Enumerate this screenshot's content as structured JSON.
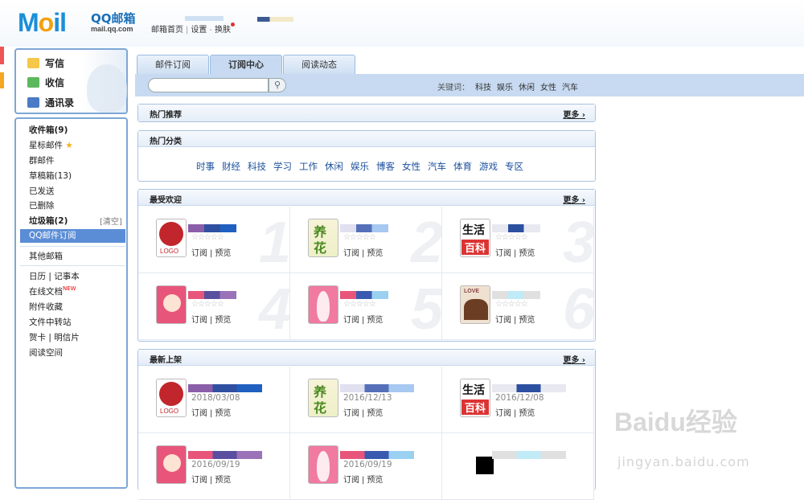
{
  "header": {
    "logo_text": "Mail",
    "brand": "QQ邮箱",
    "domain": "mail.qq.com",
    "links": [
      "邮箱首页",
      "设置",
      "换肤"
    ]
  },
  "sidebar": {
    "actions": [
      {
        "label": "写信",
        "icon": "compose-icon"
      },
      {
        "label": "收信",
        "icon": "inbox-download-icon"
      },
      {
        "label": "通讯录",
        "icon": "contacts-icon"
      }
    ],
    "folders": [
      {
        "label": "收件箱(9)",
        "bold": true
      },
      {
        "label": "星标邮件",
        "star": true
      },
      {
        "label": "群邮件"
      },
      {
        "label": "草稿箱(13)"
      },
      {
        "label": "已发送"
      },
      {
        "label": "已删除"
      },
      {
        "label": "垃圾箱(2)",
        "bold": true
      },
      {
        "label": "QQ邮件订阅",
        "selected": true
      },
      {
        "label": "其他邮箱"
      },
      {
        "label": "日历 | 记事本"
      },
      {
        "label": "在线文档"
      },
      {
        "label": "附件收藏"
      },
      {
        "label": "文件中转站"
      },
      {
        "label": "贺卡 | 明信片"
      },
      {
        "label": "阅读空间"
      }
    ],
    "clear_label": "[清空]",
    "new_badge": "NEW"
  },
  "main": {
    "tabs": [
      {
        "label": "邮件订阅",
        "active": false
      },
      {
        "label": "订阅中心",
        "active": true
      },
      {
        "label": "阅读动态",
        "active": false
      }
    ],
    "search": {
      "placeholder": "",
      "button_icon": "magnifier-icon"
    },
    "keywords_label": "关键词：",
    "keywords": [
      "科技",
      "娱乐",
      "休闲",
      "女性",
      "汽车"
    ],
    "hot_recommend": {
      "title": "热门推荐",
      "more": "更多"
    },
    "hot_categories": {
      "title": "热门分类",
      "items": [
        "时事",
        "财经",
        "科技",
        "学习",
        "工作",
        "休闲",
        "娱乐",
        "博客",
        "女性",
        "汽车",
        "体育",
        "游戏",
        "专区"
      ]
    },
    "popular": {
      "title": "最受欢迎",
      "more": "更多",
      "items": [
        {
          "num": "1",
          "thumb": "logo",
          "stars": "☆☆☆☆☆"
        },
        {
          "num": "2",
          "thumb": "yang",
          "stars": "☆☆☆☆☆"
        },
        {
          "num": "3",
          "thumb": "life",
          "stars": "☆☆☆☆☆"
        },
        {
          "num": "4",
          "thumb": "baby",
          "stars": "☆☆☆☆☆"
        },
        {
          "num": "5",
          "thumb": "preg",
          "stars": "☆☆☆☆☆"
        },
        {
          "num": "6",
          "thumb": "love",
          "stars": "☆☆☆☆☆"
        }
      ]
    },
    "latest": {
      "title": "最新上架",
      "more": "更多",
      "items": [
        {
          "thumb": "logo",
          "date": "2018/03/08"
        },
        {
          "thumb": "yang",
          "date": "2016/12/13"
        },
        {
          "thumb": "life",
          "date": "2016/12/08"
        },
        {
          "thumb": "baby",
          "date": "2016/09/19"
        },
        {
          "thumb": "preg",
          "date": "2016/09/19"
        },
        {
          "thumb": "blank",
          "date": ""
        }
      ]
    },
    "subscribe_label": "订阅",
    "preview_label": "预览",
    "thumb_text": {
      "logo": "LOGO",
      "yang": "养花",
      "life_top": "生活",
      "life_bottom": "百科",
      "love": "LOVE"
    }
  },
  "watermark": {
    "text": "Baidu经验",
    "url": "jingyan.baidu.com"
  }
}
